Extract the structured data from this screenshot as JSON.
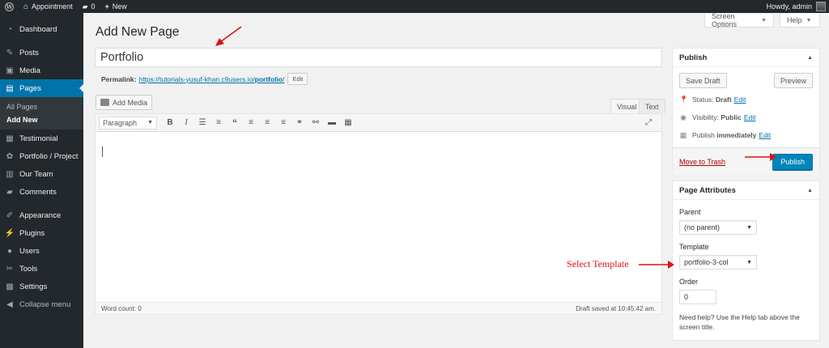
{
  "adminbar": {
    "site_name": "Appointment",
    "comments_count": "0",
    "new_label": "New",
    "greeting": "Howdy, admin"
  },
  "sidebar": {
    "items": [
      {
        "label": "Dashboard",
        "icon": "dashboard-icon"
      },
      {
        "label": "Posts",
        "icon": "pin-icon"
      },
      {
        "label": "Media",
        "icon": "media-icon"
      },
      {
        "label": "Pages",
        "icon": "page-icon"
      },
      {
        "label": "Testimonial",
        "icon": "testimonial-icon"
      },
      {
        "label": "Portfolio / Project",
        "icon": "portfolio-icon"
      },
      {
        "label": "Our Team",
        "icon": "team-icon"
      },
      {
        "label": "Comments",
        "icon": "comment-icon"
      },
      {
        "label": "Appearance",
        "icon": "brush-icon"
      },
      {
        "label": "Plugins",
        "icon": "plugin-icon"
      },
      {
        "label": "Users",
        "icon": "user-icon"
      },
      {
        "label": "Tools",
        "icon": "wrench-icon"
      },
      {
        "label": "Settings",
        "icon": "settings-icon"
      },
      {
        "label": "Collapse menu",
        "icon": "collapse-icon"
      }
    ],
    "submenu": {
      "all_pages": "All Pages",
      "add_new": "Add New"
    }
  },
  "screen_options": "Screen Options",
  "help": "Help",
  "page_title": "Add New Page",
  "post_title": "Portfolio",
  "permalink": {
    "label": "Permalink:",
    "url_base": "https://tutorials-yusuf-khan.c9users.io/",
    "slug": "portfolio",
    "trailing": "/",
    "edit": "Edit"
  },
  "add_media": "Add Media",
  "editor": {
    "tab_visual": "Visual",
    "tab_text": "Text",
    "format": "Paragraph",
    "word_count": "Word count: 0",
    "saved": "Draft saved at 10:45:42 am."
  },
  "publish": {
    "title": "Publish",
    "save_draft": "Save Draft",
    "preview": "Preview",
    "status_label": "Status:",
    "status_value": "Draft",
    "visibility_label": "Visibility:",
    "visibility_value": "Public",
    "publish_label": "Publish",
    "publish_value": "immediately",
    "edit": "Edit",
    "trash": "Move to Trash",
    "publish_button": "Publish"
  },
  "attributes": {
    "title": "Page Attributes",
    "parent_label": "Parent",
    "parent_value": "(no parent)",
    "template_label": "Template",
    "template_value": "portfolio-3-col",
    "order_label": "Order",
    "order_value": "0",
    "help": "Need help? Use the Help tab above the screen title."
  },
  "annotation": "Select Template",
  "colors": {
    "accent": "#0073aa",
    "annotation": "#dd1111",
    "sidebar": "#23282d"
  }
}
